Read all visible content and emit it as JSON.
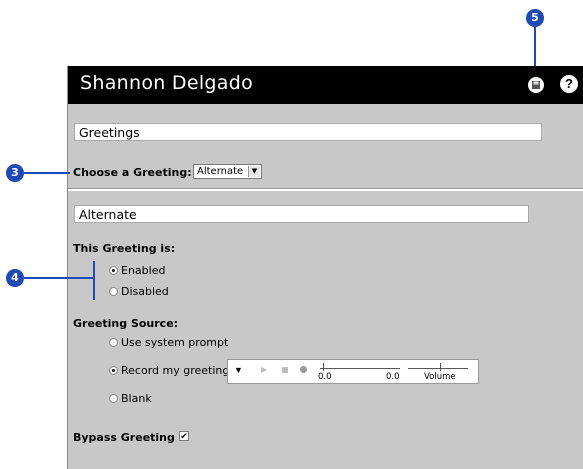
{
  "header": {
    "user_name": "Shannon Delgado"
  },
  "callouts": {
    "c3": "3",
    "c4": "4",
    "c5": "5"
  },
  "greetings": {
    "section_title": "Greetings",
    "choose_label": "Choose a Greeting:",
    "selected": "Alternate"
  },
  "alternate": {
    "section_title": "Alternate",
    "status_label": "This Greeting is:",
    "status_options": [
      {
        "label": "Enabled",
        "selected": true
      },
      {
        "label": "Disabled",
        "selected": false
      }
    ],
    "source_label": "Greeting Source:",
    "source_options": [
      {
        "label": "Use system prompt",
        "selected": false
      },
      {
        "label": "Record my greeting",
        "selected": true
      },
      {
        "label": "Blank",
        "selected": false
      }
    ],
    "player": {
      "position_value": "0.0",
      "length_value": "0.0",
      "volume_label": "Volume"
    },
    "bypass_label": "Bypass Greeting",
    "bypass_checked": true
  },
  "colors": {
    "callout": "#1e49b8",
    "header_bg": "#000000",
    "panel_bg": "#c8c8c8"
  },
  "icons": [
    "save-icon",
    "help-icon",
    "dropdown-arrow-icon",
    "play-icon",
    "stop-icon",
    "record-icon"
  ]
}
